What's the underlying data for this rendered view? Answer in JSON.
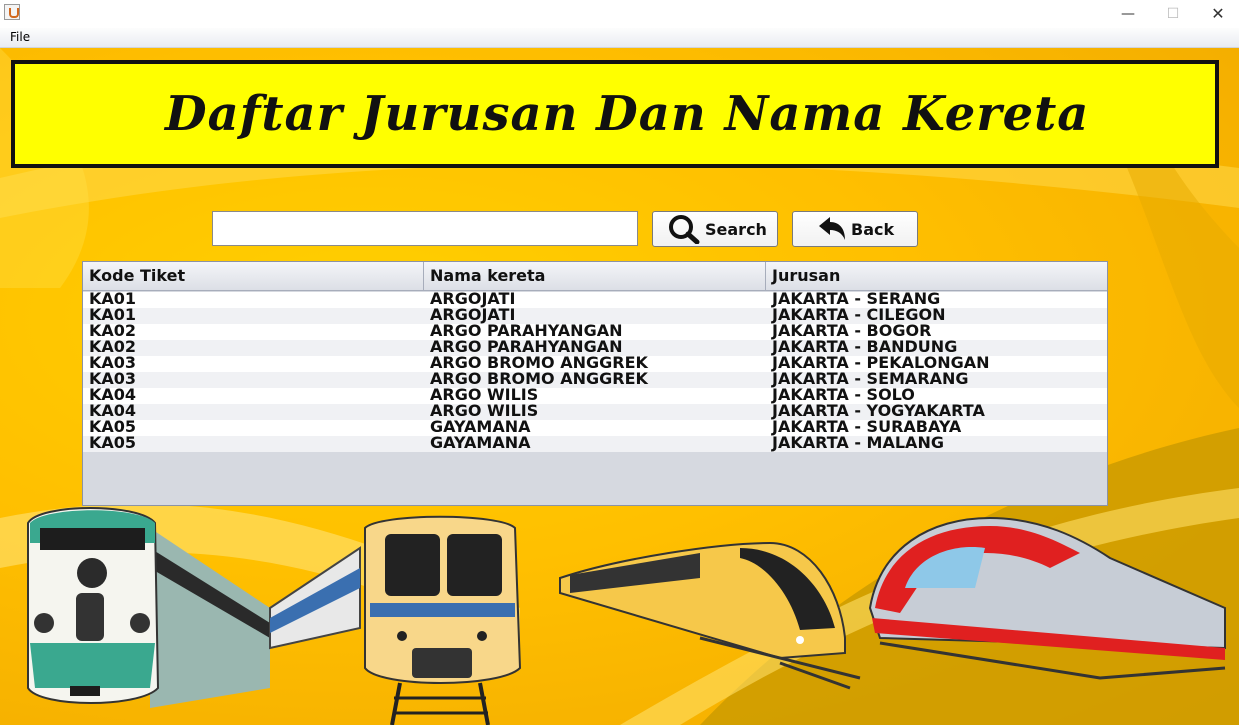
{
  "window": {
    "minimize_glyph": "—",
    "maximize_glyph": "☐",
    "close_glyph": "✕"
  },
  "menu": {
    "items": [
      {
        "label": "File"
      }
    ]
  },
  "banner": {
    "title": "Daftar Jurusan Dan Nama Kereta"
  },
  "search": {
    "value": "",
    "placeholder": "",
    "search_label": "Search",
    "back_label": "Back"
  },
  "table": {
    "columns": [
      "Kode Tiket",
      "Nama kereta",
      "Jurusan"
    ],
    "rows": [
      [
        "KA01",
        "ARGOJATI",
        "JAKARTA - SERANG"
      ],
      [
        "KA01",
        "ARGOJATI",
        "JAKARTA - CILEGON"
      ],
      [
        "KA02",
        "ARGO PARAHYANGAN",
        "JAKARTA - BOGOR"
      ],
      [
        "KA02",
        "ARGO PARAHYANGAN",
        "JAKARTA - BANDUNG"
      ],
      [
        "KA03",
        "ARGO BROMO ANGGREK",
        "JAKARTA - PEKALONGAN"
      ],
      [
        "KA03",
        "ARGO BROMO ANGGREK",
        "JAKARTA - SEMARANG"
      ],
      [
        "KA04",
        "ARGO WILIS",
        "JAKARTA - SOLO"
      ],
      [
        "KA04",
        "ARGO WILIS",
        "JAKARTA - YOGYAKARTA"
      ],
      [
        "KA05",
        "GAYAMANA",
        "JAKARTA - SURABAYA"
      ],
      [
        "KA05",
        "GAYAMANA",
        "JAKARTA - MALANG"
      ]
    ]
  },
  "colors": {
    "banner_bg": "#ffff00",
    "background": "#ffbf00"
  }
}
